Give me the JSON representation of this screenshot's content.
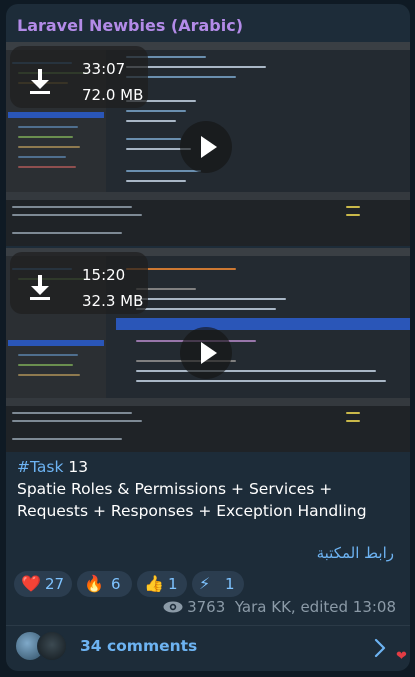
{
  "channel": {
    "title": "Laravel Newbies (Arabic)"
  },
  "videos": [
    {
      "duration": "33:07",
      "size": "72.0 MB"
    },
    {
      "duration": "15:20",
      "size": "32.3 MB"
    }
  ],
  "caption": {
    "hashtag": "#Task",
    "number": " 13",
    "text": "Spatie Roles & Permissions + Services + Requests + Responses + Exception Handling"
  },
  "library_link": "رابط المكتبة",
  "reactions": [
    {
      "emoji": "❤️",
      "count": "27",
      "icon": "heart-icon"
    },
    {
      "emoji": "🔥",
      "count": "6",
      "icon": "fire-icon"
    },
    {
      "emoji": "👍",
      "count": "1",
      "icon": "thumbs-up-icon"
    },
    {
      "emoji": "⚡",
      "count": "1",
      "icon": "lightning-icon"
    }
  ],
  "meta": {
    "views": "3763",
    "author_edited": "Yara KK, edited 13:08"
  },
  "comments": {
    "label": "34 comments"
  },
  "colors": {
    "background": "#0f1a24",
    "bubble": "#1d2c39",
    "title": "#b38be8",
    "link": "#6db3f2",
    "meta": "#8b9aa7"
  }
}
